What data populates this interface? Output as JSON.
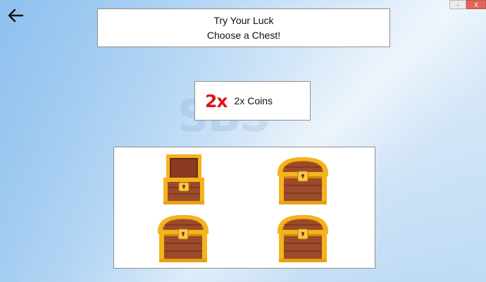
{
  "window": {
    "minimize_label": "-",
    "close_label": "X"
  },
  "header": {
    "title_line1": "Try Your Luck",
    "title_line2": "Choose a Chest!"
  },
  "multiplier": {
    "badge": "2x",
    "label": "2x Coins",
    "badge_color": "#e0151b"
  },
  "watermark": {
    "text": "SBS"
  },
  "icons": {
    "back": "back-arrow-icon",
    "chest": "treasure-chest-icon"
  },
  "chests": [
    {
      "id": "chest-1",
      "state": "open"
    },
    {
      "id": "chest-2",
      "state": "closed"
    },
    {
      "id": "chest-3",
      "state": "closed"
    },
    {
      "id": "chest-4",
      "state": "closed"
    }
  ],
  "colors": {
    "chest_wood": "#9b4a2a",
    "chest_gold": "#f4b41c",
    "chest_gold_dark": "#d48b0c"
  }
}
